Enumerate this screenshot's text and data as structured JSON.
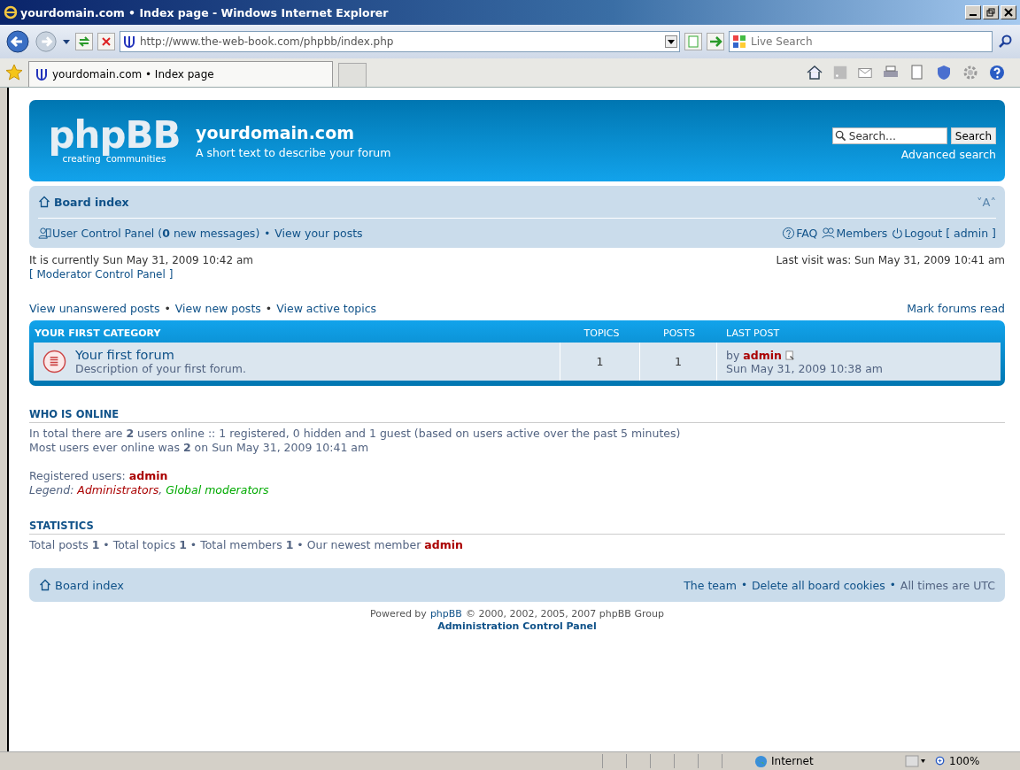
{
  "browser": {
    "title": "yourdomain.com • Index page - Windows Internet Explorer",
    "address": "http://www.the-web-book.com/phpbb/index.php",
    "search_placeholder": "Live Search",
    "tab_title": "yourdomain.com • Index page",
    "status_zone": "Internet",
    "zoom": "100%"
  },
  "header": {
    "logo": "phpBB",
    "logo_tagline": [
      "creating",
      "communities"
    ],
    "site_name": "yourdomain.com",
    "site_description": "A short text to describe your forum",
    "search_placeholder": "Search…",
    "search_button": "Search",
    "advanced_search": "Advanced search"
  },
  "navbar": {
    "breadcrumb": "Board index",
    "font_resize": "˅A˄",
    "ucp": "User Control Panel (**0** new messages)",
    "separator": "•",
    "view_posts": "View your posts",
    "right_links": [
      {
        "kind": "faq",
        "label": "FAQ"
      },
      {
        "kind": "members",
        "label": "Members"
      },
      {
        "kind": "logout",
        "label": "Logout [ admin ]"
      }
    ]
  },
  "info": {
    "current_time": "It is currently Sun May 31, 2009 10:42 am",
    "last_visit": "Last visit was: Sun May 31, 2009 10:41 am",
    "mcp": "[ Moderator Control Panel ]"
  },
  "quick_links": [
    "View unanswered posts",
    "View new posts",
    "View active topics"
  ],
  "quick_links_separator": "•",
  "mark_read": "Mark forums read",
  "forum_table": {
    "category": "YOUR FIRST CATEGORY",
    "columns": [
      "TOPICS",
      "POSTS",
      "LAST POST"
    ],
    "rows": [
      {
        "title": "Your first forum",
        "description": "Description of your first forum.",
        "topics": "1",
        "posts": "1",
        "last_post_prefix": "by",
        "last_post_author": "admin",
        "last_post_time": "Sun May 31, 2009 10:38 am"
      }
    ]
  },
  "who_is_online": {
    "heading": "WHO IS ONLINE",
    "lines": [
      "In total there are **2** users online :: 1 registered, 0 hidden and 1 guest (based on users active over the past 5 minutes)",
      "Most users ever online was **2** on Sun May 31, 2009 10:41 am"
    ],
    "registered_label": "Registered users:",
    "registered_users": [
      {
        "name": "admin",
        "color": "#aa0000"
      }
    ],
    "legend_label": "Legend:",
    "legend_separator": ",",
    "legend": [
      {
        "name": "Administrators",
        "color": "#aa0000"
      },
      {
        "name": "Global moderators",
        "color": "#00aa00"
      }
    ]
  },
  "statistics": {
    "heading": "STATISTICS",
    "text": "Total posts **1** • Total topics **1** • Total members **1** • Our newest member",
    "newest_member": {
      "name": "admin",
      "color": "#aa0000"
    }
  },
  "footer": {
    "breadcrumb": "Board index",
    "links": [
      "The team",
      "Delete all board cookies"
    ],
    "separator": "•",
    "timezone": "All times are UTC",
    "powered_prefix": "Powered by",
    "powered_link": "phpBB",
    "powered_suffix": "© 2000, 2002, 2005, 2007 phpBB Group",
    "acp": "Administration Control Panel"
  }
}
